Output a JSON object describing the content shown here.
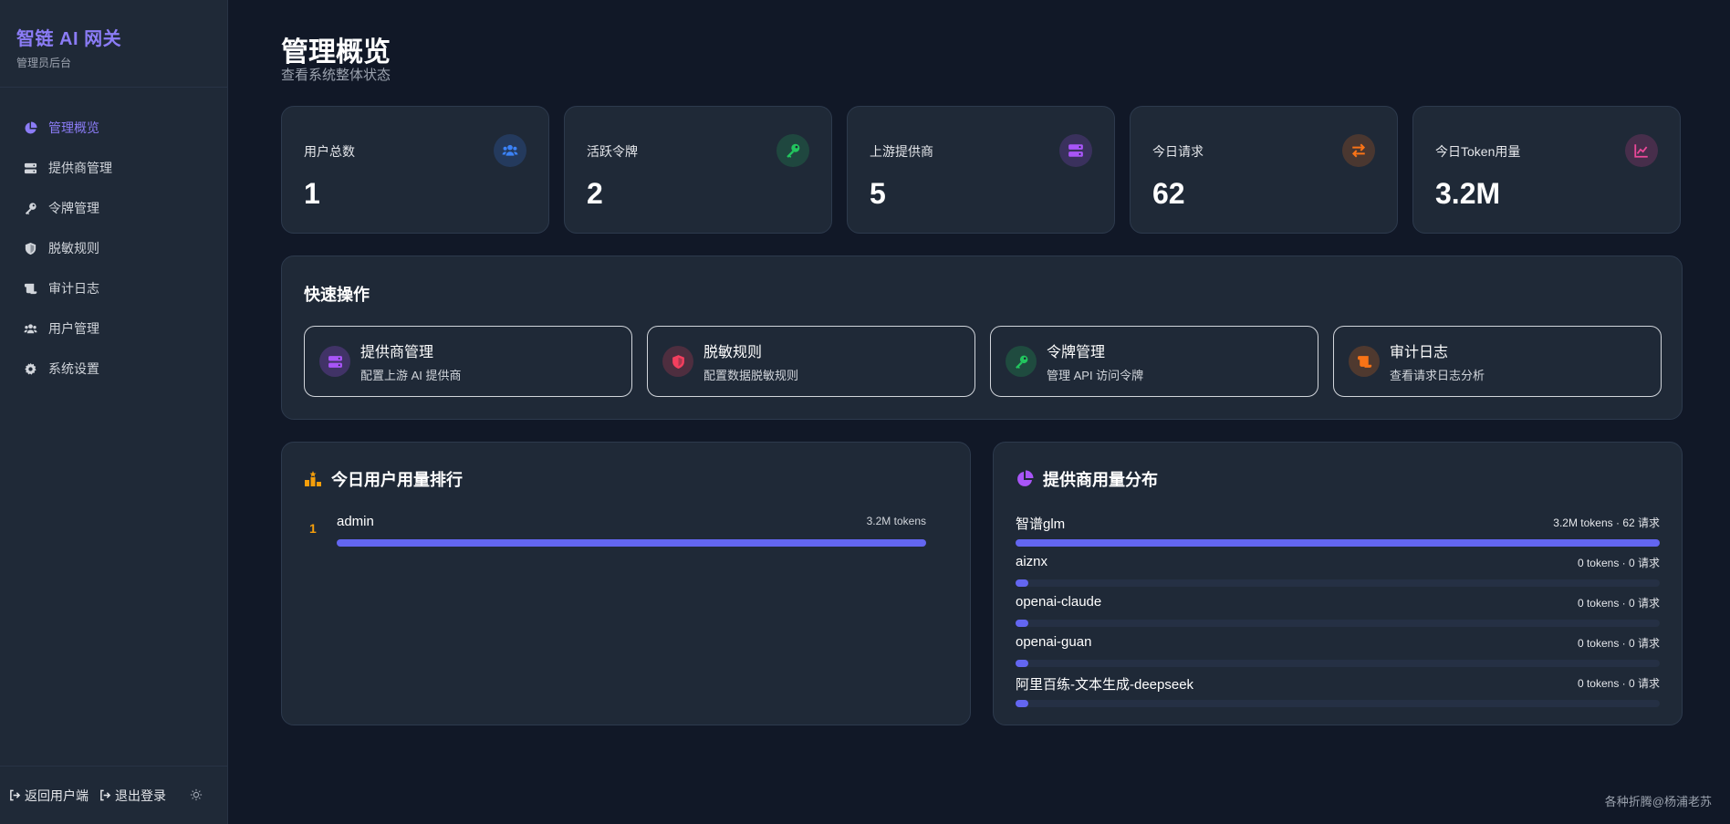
{
  "brand": {
    "title": "智链 AI 网关",
    "subtitle": "管理员后台"
  },
  "nav": {
    "items": [
      {
        "label": "管理概览",
        "icon": "pie-chart-icon",
        "active": true
      },
      {
        "label": "提供商管理",
        "icon": "server-icon"
      },
      {
        "label": "令牌管理",
        "icon": "key-icon"
      },
      {
        "label": "脱敏规则",
        "icon": "shield-icon"
      },
      {
        "label": "审计日志",
        "icon": "scroll-icon"
      },
      {
        "label": "用户管理",
        "icon": "users-icon"
      },
      {
        "label": "系统设置",
        "icon": "gear-icon"
      }
    ]
  },
  "footer": {
    "back_label": "返回用户端",
    "logout_label": "退出登录",
    "theme_icon": "sun-icon"
  },
  "header": {
    "title": "管理概览",
    "subtitle": "查看系统整体状态"
  },
  "stats": [
    {
      "label": "用户总数",
      "value": "1",
      "icon": "users-icon",
      "color": "#3b82f6"
    },
    {
      "label": "活跃令牌",
      "value": "2",
      "icon": "key-icon",
      "color": "#22c55e"
    },
    {
      "label": "上游提供商",
      "value": "5",
      "icon": "server-icon",
      "color": "#a855f7"
    },
    {
      "label": "今日请求",
      "value": "62",
      "icon": "exchange-icon",
      "color": "#f97316"
    },
    {
      "label": "今日Token用量",
      "value": "3.2M",
      "icon": "line-chart-icon",
      "color": "#ec4899"
    }
  ],
  "quick_actions": {
    "title": "快速操作",
    "items": [
      {
        "title": "提供商管理",
        "desc": "配置上游 AI 提供商",
        "icon": "server-icon",
        "color": "#a855f7"
      },
      {
        "title": "脱敏规则",
        "desc": "配置数据脱敏规则",
        "icon": "shield-icon",
        "color": "#f43f5e"
      },
      {
        "title": "令牌管理",
        "desc": "管理 API 访问令牌",
        "icon": "key-icon",
        "color": "#22c55e"
      },
      {
        "title": "审计日志",
        "desc": "查看请求日志分析",
        "icon": "scroll-icon",
        "color": "#f97316"
      }
    ]
  },
  "ranking": {
    "title": "今日用户用量排行",
    "icon": "podium-icon",
    "rows": [
      {
        "rank": "1",
        "name": "admin",
        "value": "3.2M tokens",
        "fraction": 1.0
      }
    ]
  },
  "distribution": {
    "title": "提供商用量分布",
    "icon": "pie-chart-icon",
    "rows": [
      {
        "name": "智谱glm",
        "value": "3.2M tokens · 62 请求",
        "fraction": 1.0
      },
      {
        "name": "aiznx",
        "value": "0 tokens · 0 请求",
        "fraction": 0.02
      },
      {
        "name": "openai-claude",
        "value": "0 tokens · 0 请求",
        "fraction": 0.02
      },
      {
        "name": "openai-guan",
        "value": "0 tokens · 0 请求",
        "fraction": 0.02
      },
      {
        "name": "阿里百练-文本生成-deepseek",
        "value": "0 tokens · 0 请求",
        "fraction": 0.02
      }
    ]
  },
  "watermark": "各种折腾@杨浦老苏"
}
